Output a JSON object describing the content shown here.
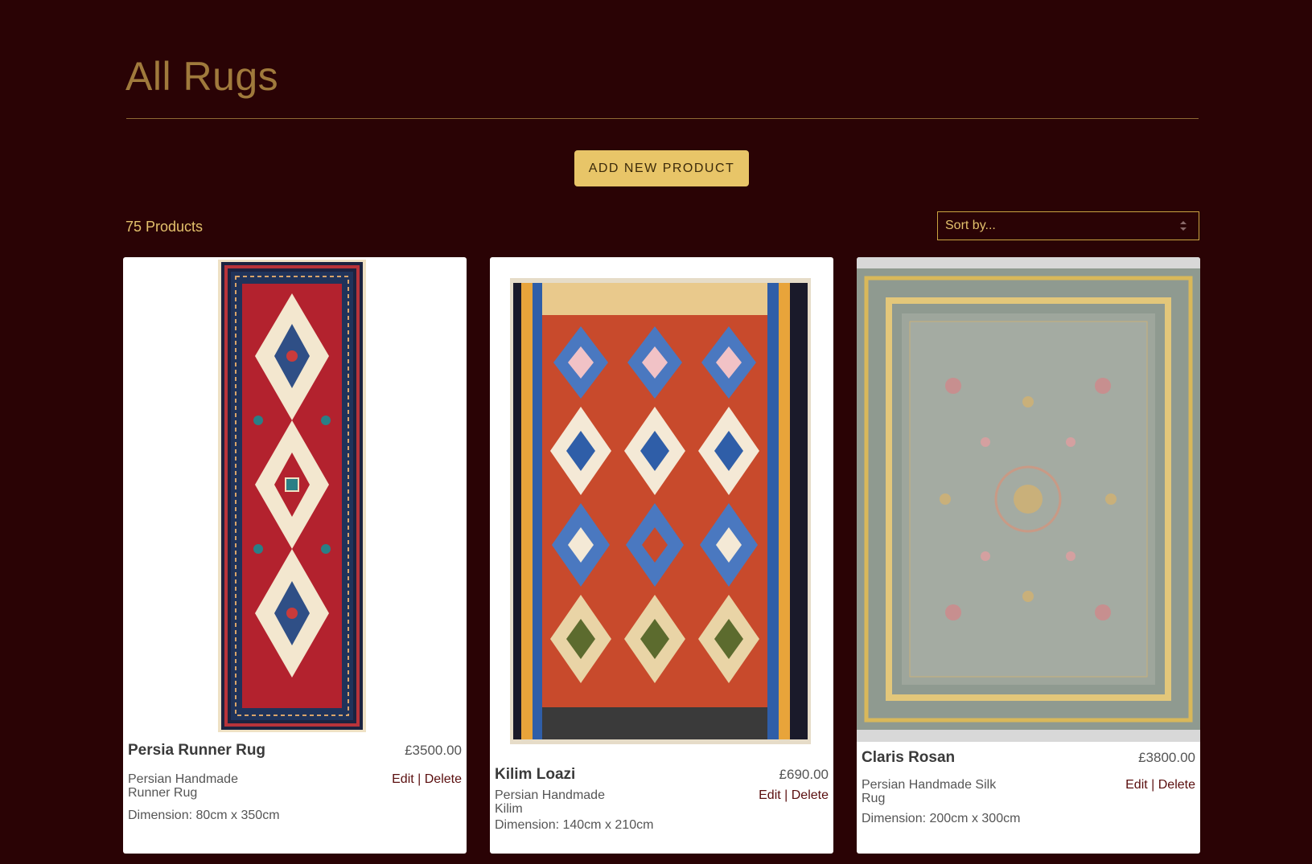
{
  "page": {
    "title": "All Rugs",
    "add_button_label": "ADD NEW PRODUCT",
    "product_count": "75 Products",
    "sort_placeholder": "Sort by..."
  },
  "products": [
    {
      "name": "Persia Runner Rug",
      "price": "£3500.00",
      "category": "Persian Handmade Runner Rug",
      "dimension": "Dimension: 80cm x 350cm",
      "edit_label": "Edit",
      "separator": " | ",
      "delete_label": "Delete"
    },
    {
      "name": "Kilim Loazi",
      "price": "£690.00",
      "category": "Persian Handmade Kilim",
      "dimension": "Dimension: 140cm x 210cm",
      "edit_label": "Edit",
      "separator": " | ",
      "delete_label": "Delete"
    },
    {
      "name": "Claris Rosan",
      "price": "£3800.00",
      "category": "Persian Handmade Silk Rug",
      "dimension": "Dimension: 200cm x 300cm",
      "edit_label": "Edit",
      "separator": " | ",
      "delete_label": "Delete"
    }
  ],
  "colors": {
    "background": "#2a0305",
    "title": "#a07a3c",
    "accent": "#e8c568",
    "link": "#5a0e0e"
  }
}
